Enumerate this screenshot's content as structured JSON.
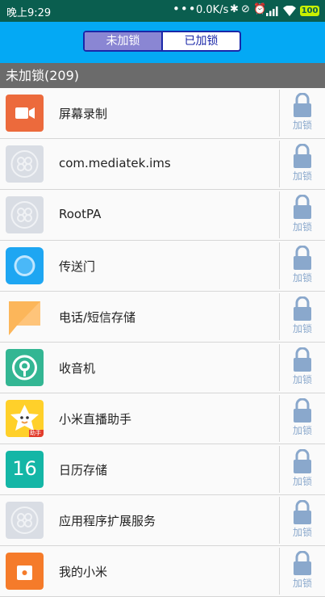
{
  "status_bar": {
    "time": "晚上9:29",
    "dots": "•••",
    "speed": "0.0K/s",
    "icons": [
      "bluetooth-icon",
      "alarm-off-icon",
      "alarm-icon",
      "signal-icon",
      "wifi-icon"
    ],
    "battery": "100"
  },
  "tabs": {
    "unlocked": "未加锁",
    "locked": "已加锁"
  },
  "section_header": "未加锁(209)",
  "lock_label": "加锁",
  "apps": [
    {
      "name": "屏幕录制",
      "icon": "video-camera-icon"
    },
    {
      "name": "com.mediatek.ims",
      "icon": "default-app-icon"
    },
    {
      "name": "RootPA",
      "icon": "default-app-icon"
    },
    {
      "name": "传送门",
      "icon": "portal-icon"
    },
    {
      "name": "电话/短信存储",
      "icon": "message-storage-icon"
    },
    {
      "name": "收音机",
      "icon": "radio-icon"
    },
    {
      "name": "小米直播助手",
      "icon": "live-assistant-icon",
      "badge": "助手"
    },
    {
      "name": "日历存储",
      "icon": "calendar-icon",
      "day": "16"
    },
    {
      "name": "应用程序扩展服务",
      "icon": "default-app-icon"
    },
    {
      "name": "我的小米",
      "icon": "my-mi-icon"
    }
  ],
  "colors": {
    "status_bar": "#0a5e4f",
    "toolbar": "#04a9f4",
    "section_header": "#6b6b6b",
    "lock": "#8aa8cc"
  }
}
